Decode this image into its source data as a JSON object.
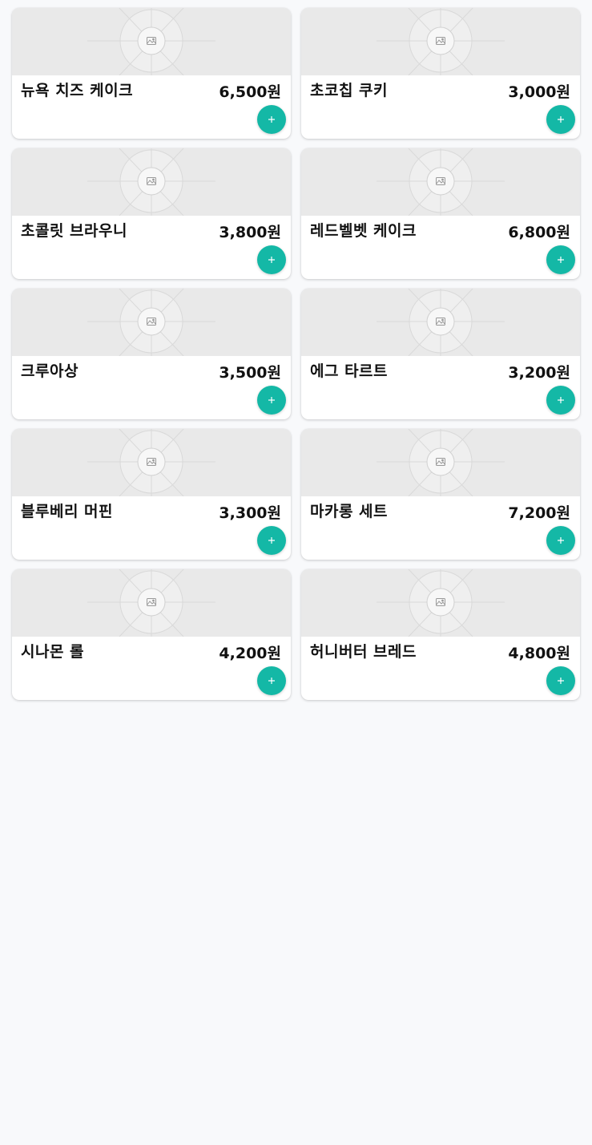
{
  "accent_color": "#14b8a6",
  "products": [
    {
      "name": "뉴욕 치즈 케이크",
      "price": "6,500원",
      "image_icon": "image-placeholder-icon",
      "add_icon": "plus-icon"
    },
    {
      "name": "초코칩 쿠키",
      "price": "3,000원",
      "image_icon": "image-placeholder-icon",
      "add_icon": "plus-icon"
    },
    {
      "name": "초콜릿 브라우니",
      "price": "3,800원",
      "image_icon": "image-placeholder-icon",
      "add_icon": "plus-icon"
    },
    {
      "name": "레드벨벳 케이크",
      "price": "6,800원",
      "image_icon": "image-placeholder-icon",
      "add_icon": "plus-icon"
    },
    {
      "name": "크루아상",
      "price": "3,500원",
      "image_icon": "image-placeholder-icon",
      "add_icon": "plus-icon"
    },
    {
      "name": "에그 타르트",
      "price": "3,200원",
      "image_icon": "image-placeholder-icon",
      "add_icon": "plus-icon"
    },
    {
      "name": "블루베리 머핀",
      "price": "3,300원",
      "image_icon": "image-placeholder-icon",
      "add_icon": "plus-icon"
    },
    {
      "name": "마카롱 세트",
      "price": "7,200원",
      "image_icon": "image-placeholder-icon",
      "add_icon": "plus-icon"
    },
    {
      "name": "시나몬 롤",
      "price": "4,200원",
      "image_icon": "image-placeholder-icon",
      "add_icon": "plus-icon"
    },
    {
      "name": "허니버터 브레드",
      "price": "4,800원",
      "image_icon": "image-placeholder-icon",
      "add_icon": "plus-icon"
    }
  ]
}
